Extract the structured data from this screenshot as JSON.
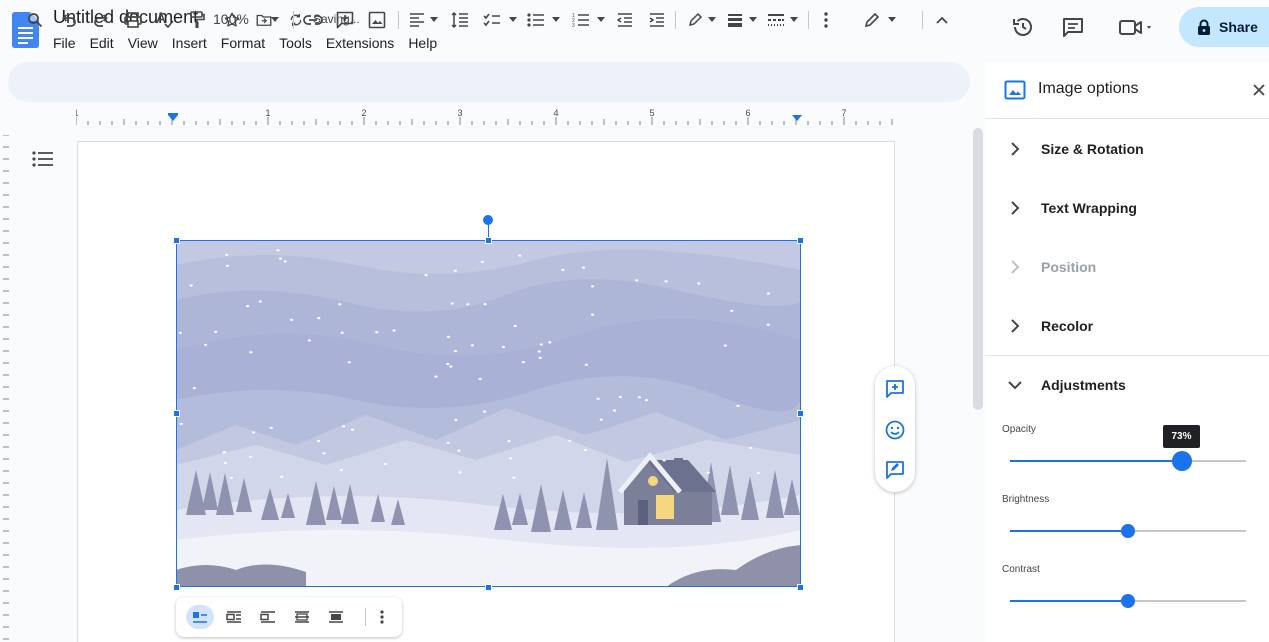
{
  "document": {
    "title": "Untitled document",
    "status": "Saving..."
  },
  "menu": [
    "File",
    "Edit",
    "View",
    "Insert",
    "Format",
    "Tools",
    "Extensions",
    "Help"
  ],
  "share": {
    "label": "Share"
  },
  "toolbar": {
    "zoom": "100%"
  },
  "ruler": {
    "numbers": [
      "1",
      "1",
      "2",
      "3",
      "4",
      "5",
      "6",
      "7"
    ]
  },
  "panel": {
    "title": "Image options",
    "sections": [
      {
        "label": "Size & Rotation",
        "expanded": false,
        "enabled": true
      },
      {
        "label": "Text Wrapping",
        "expanded": false,
        "enabled": true
      },
      {
        "label": "Position",
        "expanded": false,
        "enabled": false
      },
      {
        "label": "Recolor",
        "expanded": false,
        "enabled": true
      },
      {
        "label": "Adjustments",
        "expanded": true,
        "enabled": true
      }
    ],
    "adjustments": {
      "opacity": {
        "label": "Opacity",
        "value": 73,
        "tooltip": "73%"
      },
      "brightness": {
        "label": "Brightness",
        "value": 50
      },
      "contrast": {
        "label": "Contrast",
        "value": 50
      }
    }
  },
  "colors": {
    "accent": "#1a73e8",
    "share_bg": "#c2e7ff",
    "toolbar_bg": "#edf2fa"
  }
}
